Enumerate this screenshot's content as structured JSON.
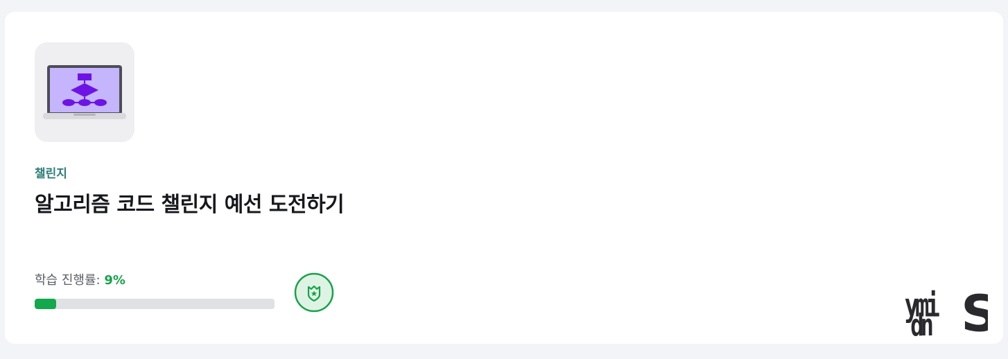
{
  "course": {
    "thumbnail_icon": "flowchart-laptop-icon",
    "category": "챌린지",
    "title": "알고리즘 코드 챌린지 예선 도전하기"
  },
  "progress": {
    "label": "학습 진행률:",
    "value_text": "9%",
    "fraction": 0.09,
    "fill_color": "#12a84b"
  },
  "badge": {
    "icon": "shield-star-badge-icon",
    "color": "#15a34a"
  },
  "logo": {
    "icon": "brand-logo",
    "text": "ymidnS"
  }
}
